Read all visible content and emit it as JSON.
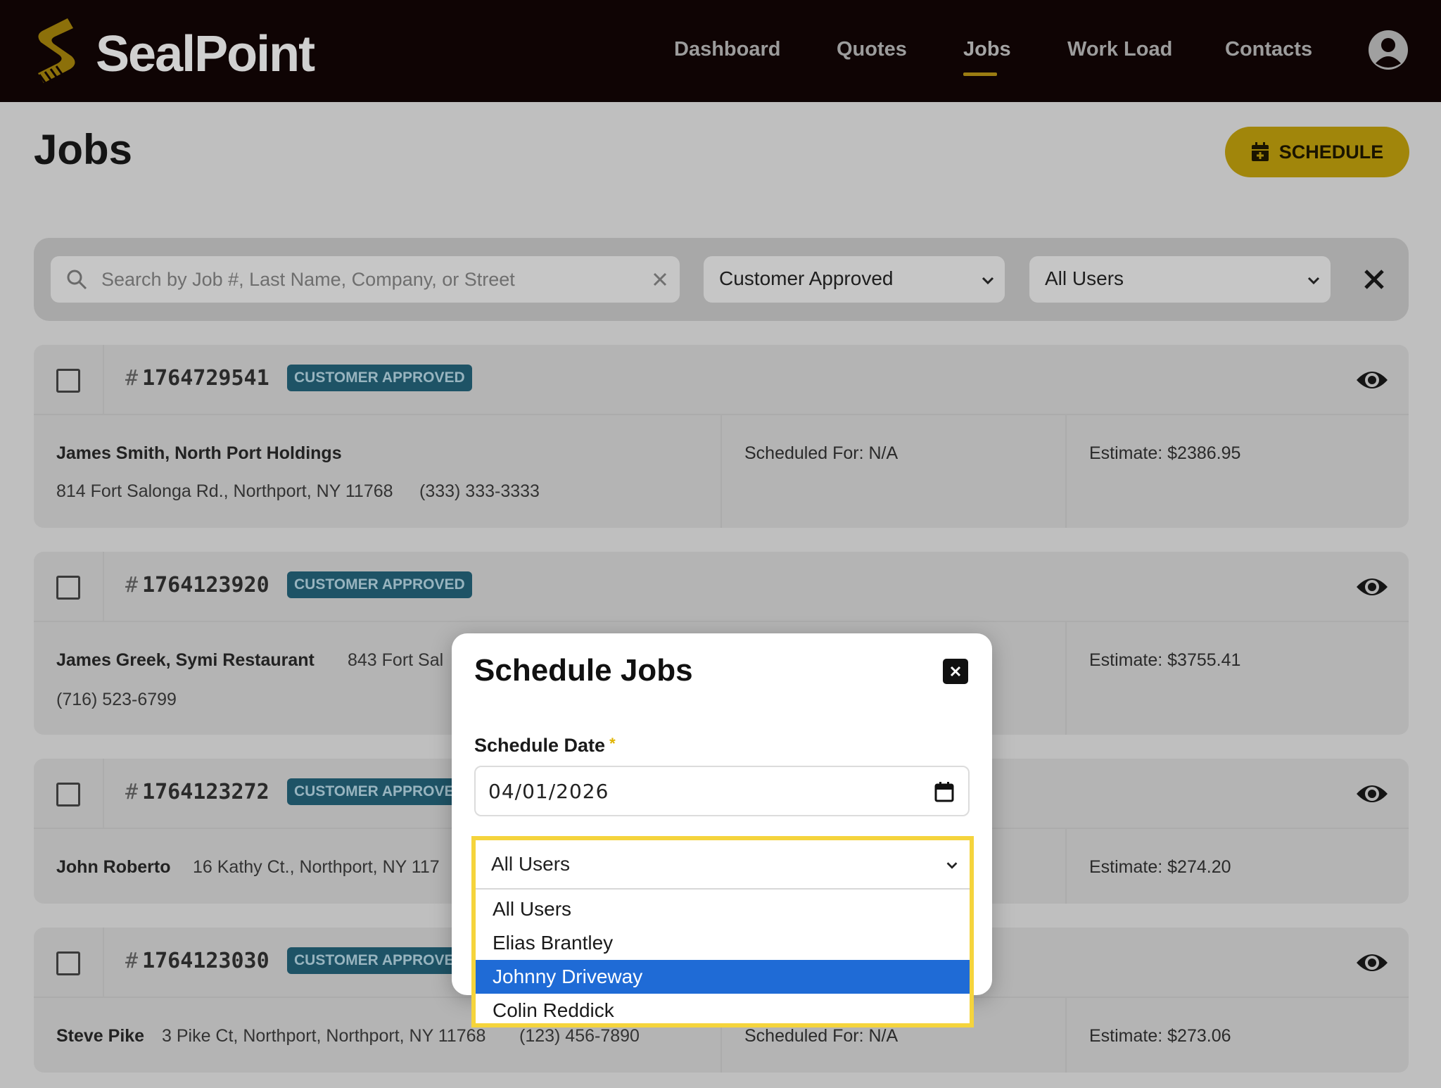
{
  "header": {
    "logo_text": "SealPoint",
    "nav": [
      {
        "label": "Dashboard"
      },
      {
        "label": "Quotes"
      },
      {
        "label": "Jobs",
        "active": true
      },
      {
        "label": "Work Load"
      },
      {
        "label": "Contacts"
      }
    ]
  },
  "page": {
    "title": "Jobs",
    "schedule_button": "SCHEDULE"
  },
  "filters": {
    "search_placeholder": "Search by Job #, Last Name, Company, or Street",
    "status_value": "Customer Approved",
    "user_value": "All Users"
  },
  "jobs": [
    {
      "number": "1764729541",
      "status": "CUSTOMER APPROVED",
      "customer": "James Smith, North Port Holdings",
      "address": "814 Fort Salonga Rd., Northport, NY 11768",
      "phone": "(333) 333-3333",
      "scheduled": "Scheduled For: N/A",
      "estimate": "Estimate: $2386.95"
    },
    {
      "number": "1764123920",
      "status": "CUSTOMER APPROVED",
      "customer": "James Greek, Symi Restaurant",
      "address": "843 Fort Sal",
      "phone": "(716) 523-6799",
      "scheduled": "",
      "estimate": "Estimate: $3755.41"
    },
    {
      "number": "1764123272",
      "status": "CUSTOMER APPROVE",
      "customer": "John Roberto",
      "address": "16 Kathy Ct., Northport, NY 117",
      "phone": "",
      "scheduled": "",
      "estimate": "Estimate: $274.20"
    },
    {
      "number": "1764123030",
      "status": "CUSTOMER APPROVE",
      "customer": "Steve Pike",
      "address": "3 Pike Ct, Northport, Northport, NY 11768",
      "phone": "(123) 456-7890",
      "scheduled": "Scheduled For: N/A",
      "estimate": "Estimate: $273.06"
    }
  ],
  "modal": {
    "title": "Schedule Jobs",
    "date_label": "Schedule Date",
    "required_mark": "*",
    "date_value": "04/01/2026",
    "user_select": {
      "value": "All Users",
      "options": [
        "All Users",
        "Elias Brantley",
        "Johnny Driveway",
        "Colin Reddick"
      ],
      "highlighted": "Johnny Driveway"
    }
  },
  "colors": {
    "header_bg": "#0f0404",
    "accent_yellow": "#f5c518",
    "badge_teal": "#1e5366",
    "option_highlight": "#1f6bd6",
    "focus_outline": "#f5d43c"
  }
}
